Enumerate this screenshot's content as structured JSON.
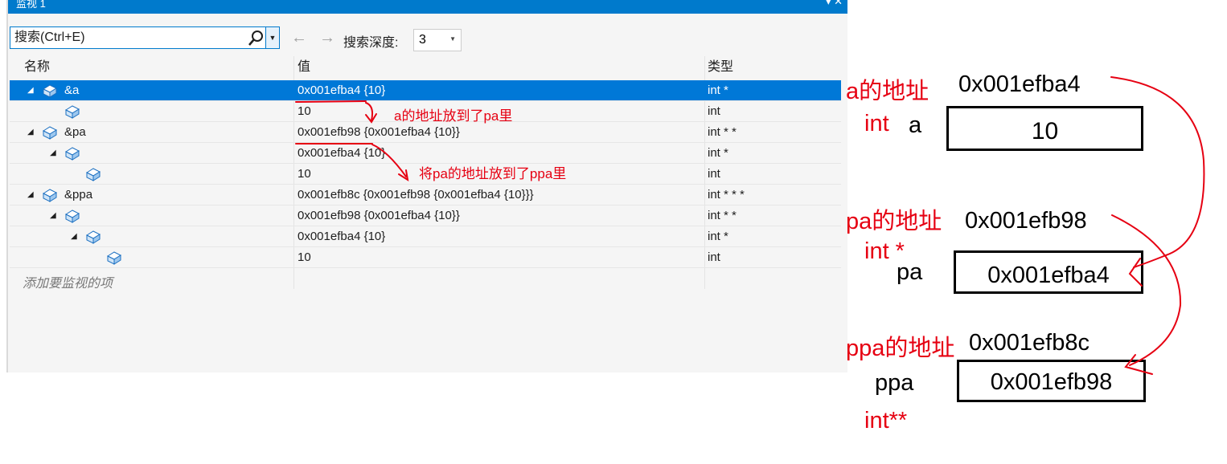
{
  "window": {
    "title": "监视 1",
    "title_controls": "▾ ✕"
  },
  "toolbar": {
    "search_placeholder": "搜索(Ctrl+E)",
    "back_arrow": "←",
    "forward_arrow": "→",
    "depth_label": "搜索深度:",
    "depth_value": "3"
  },
  "grid": {
    "headers": {
      "name": "名称",
      "value": "值",
      "type": "类型"
    },
    "rows": [
      {
        "name": "&a",
        "value": "0x001efba4 {10}",
        "type": "int *"
      },
      {
        "name": "",
        "value": "10",
        "type": "int"
      },
      {
        "name": "&pa",
        "value": "0x001efb98 {0x001efba4 {10}}",
        "type": "int * *"
      },
      {
        "name": "",
        "value": "0x001efba4 {10}",
        "type": "int *"
      },
      {
        "name": "",
        "value": "10",
        "type": "int"
      },
      {
        "name": "&ppa",
        "value": "0x001efb8c {0x001efb98 {0x001efba4 {10}}}",
        "type": "int * * *"
      },
      {
        "name": "",
        "value": "0x001efb98 {0x001efba4 {10}}",
        "type": "int * *"
      },
      {
        "name": "",
        "value": "0x001efba4 {10}",
        "type": "int *"
      },
      {
        "name": "",
        "value": "10",
        "type": "int"
      }
    ],
    "add_item_placeholder": "添加要监视的项"
  },
  "annotations": {
    "a_to_pa": "a的地址放到了pa里",
    "pa_to_ppa": "将pa的地址放到了ppa里"
  },
  "diagram": {
    "a": {
      "addr_label": "a的地址",
      "addr": "0x001efba4",
      "type": "int",
      "name": "a",
      "value": "10"
    },
    "pa": {
      "addr_label": "pa的地址",
      "addr": "0x001efb98",
      "type": "int *",
      "name": "pa",
      "value": "0x001efba4"
    },
    "ppa": {
      "addr_label": "ppa的地址",
      "addr": "0x001efb8c",
      "type": "int**",
      "name": "ppa",
      "value": "0x001efb98"
    }
  },
  "colors": {
    "annotation": "#e60012",
    "selection": "#0078d7",
    "accent": "#007acc"
  }
}
